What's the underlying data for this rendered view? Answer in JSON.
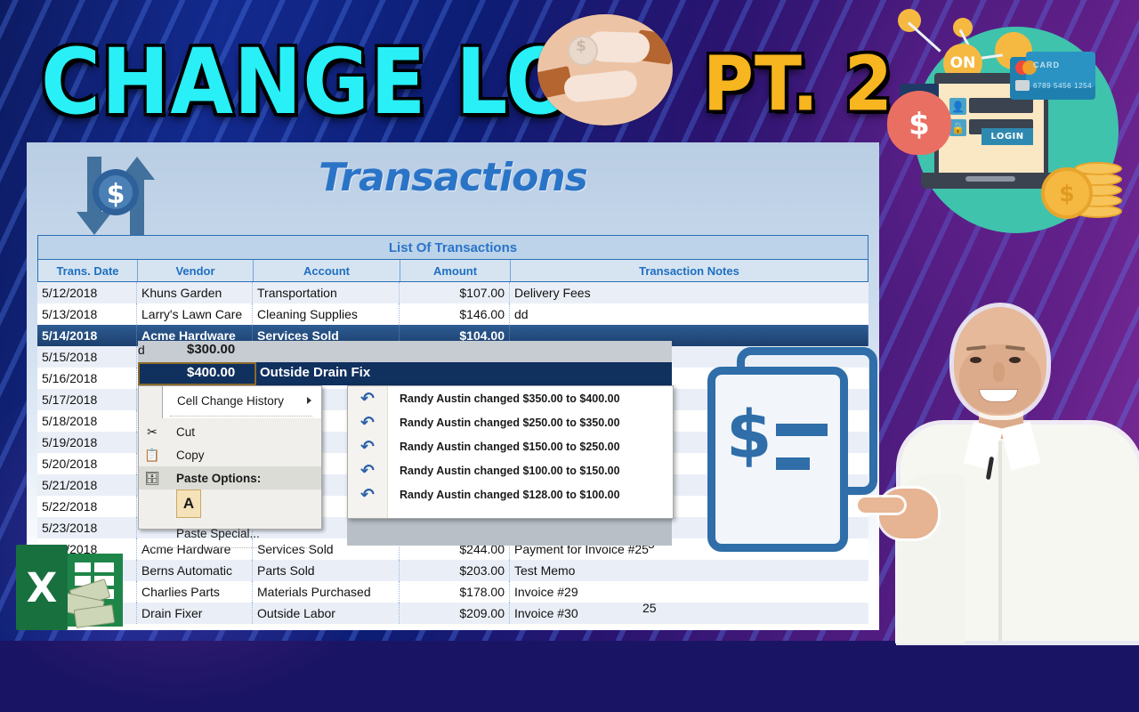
{
  "thumbnail": {
    "title_main": "CHANGE LOG",
    "title_part": "PT. 2",
    "colors": {
      "title_cyan": "#28f0f6",
      "title_gold": "#f7b520",
      "bg_blue": "#132a8e",
      "bg_purple": "#5e1f86"
    }
  },
  "illustration": {
    "on_badge": "ON",
    "login_button": "LOGIN",
    "card_label": "CARD",
    "card_number": "6789 5456 1254",
    "money_symbol": "$",
    "coin_symbol": "$"
  },
  "spreadsheet": {
    "sheet_title": "Transactions",
    "table_banner": "List Of Transactions",
    "columns": [
      "Trans. Date",
      "Vendor",
      "Account",
      "Amount",
      "Transaction Notes"
    ],
    "rows": [
      {
        "date": "5/12/2018",
        "vendor": "Khuns Garden",
        "account": "Transportation",
        "amount": "$107.00",
        "notes": "Delivery Fees",
        "style": "alt"
      },
      {
        "date": "5/13/2018",
        "vendor": "Larry's Lawn Care",
        "account": "Cleaning Supplies",
        "amount": "$146.00",
        "notes": "dd",
        "style": "plain"
      },
      {
        "date": "5/14/2018",
        "vendor": "Acme Hardware",
        "account": "Services Sold",
        "amount": "$104.00",
        "notes": "",
        "style": "sel"
      },
      {
        "date": "5/15/2018",
        "vendor": "",
        "account": "",
        "amount": "",
        "notes": "",
        "style": "alt"
      },
      {
        "date": "5/16/2018",
        "vendor": "",
        "account": "",
        "amount": "",
        "notes": "",
        "style": "plain"
      },
      {
        "date": "5/17/2018",
        "vendor": "",
        "account": "",
        "amount": "",
        "notes": "",
        "style": "alt"
      },
      {
        "date": "5/18/2018",
        "vendor": "",
        "account": "",
        "amount": "",
        "notes": "",
        "style": "plain"
      },
      {
        "date": "5/19/2018",
        "vendor": "",
        "account": "",
        "amount": "",
        "notes": "",
        "style": "alt"
      },
      {
        "date": "5/20/2018",
        "vendor": "",
        "account": "",
        "amount": "",
        "notes": "",
        "style": "plain"
      },
      {
        "date": "5/21/2018",
        "vendor": "",
        "account": "",
        "amount": "",
        "notes": "",
        "style": "alt"
      },
      {
        "date": "5/22/2018",
        "vendor": "",
        "account": "",
        "amount": "",
        "notes": "",
        "style": "plain"
      },
      {
        "date": "5/23/2018",
        "vendor": "",
        "account": "",
        "amount": "",
        "notes": "",
        "style": "alt"
      },
      {
        "date": "5/24/2018",
        "vendor": "Acme Hardware",
        "account": "Services Sold",
        "amount": "$244.00",
        "notes": "Payment for Invoice #25",
        "style": "plain"
      },
      {
        "date": "",
        "vendor": "Berns Automatic",
        "account": "Parts Sold",
        "amount": "$203.00",
        "notes": "Test Memo",
        "style": "alt"
      },
      {
        "date": "",
        "vendor": "Charlies Parts",
        "account": "Materials Purchased",
        "amount": "$178.00",
        "notes": "Invoice #29",
        "style": "plain"
      },
      {
        "date": "",
        "vendor": "Drain Fixer",
        "account": "Outside Labor",
        "amount": "$209.00",
        "notes": "Invoice #30",
        "style": "alt"
      }
    ],
    "occluded_fragments": {
      "row_a": "5",
      "row_b": "25",
      "row_c": "5"
    }
  },
  "edit_overlay": {
    "above_amount": "$300.00",
    "selected_amount": "$400.00",
    "selected_note": "Outside Drain Fix"
  },
  "context_menu": {
    "items": [
      {
        "label": "Cell Change History",
        "icon": "submenu-arrow-icon",
        "has_submenu": true
      },
      {
        "label": "Cut",
        "icon": "scissors-icon"
      },
      {
        "label": "Copy",
        "icon": "copy-icon"
      },
      {
        "label": "Paste Options:",
        "icon": "paste-icon",
        "highlighted": true
      },
      {
        "label": "Paste Special...",
        "icon": "none"
      }
    ],
    "paste_option_glyph": "A"
  },
  "submenu": {
    "title": "Cell Change History",
    "items": [
      "Randy Austin changed $350.00 to $400.00",
      "Randy Austin changed $250.00 to $350.00",
      "Randy Austin changed $150.00 to $250.00",
      "Randy Austin changed $100.00 to $150.00",
      "Randy Austin changed $128.00 to $100.00"
    ],
    "icon": "undo-arrow-icon"
  },
  "excel_logo": {
    "letter": "X"
  }
}
